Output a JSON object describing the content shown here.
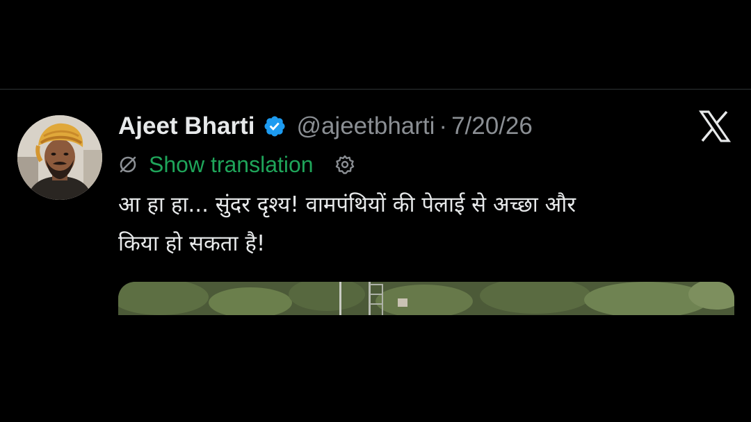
{
  "tweet": {
    "author_name": "Ajeet Bharti",
    "handle": "@ajeetbharti",
    "separator": "·",
    "date": "7/20/26",
    "translate_label": "Show translation",
    "text": "आ हा हा... सुंदर दृश्य! वामपंथियों की पेलाई से अच्छा और\nकिया हो सकता है!"
  },
  "icons": {
    "verified": "verified-badge-icon",
    "platform": "x-logo-icon",
    "translate": "translate-globe-icon",
    "settings": "gear-icon"
  },
  "colors": {
    "background": "#000000",
    "text_primary": "#e7e9ea",
    "text_secondary": "#8b8f94",
    "verified_blue": "#1d9bf0",
    "translation_green": "#1fa55a"
  }
}
